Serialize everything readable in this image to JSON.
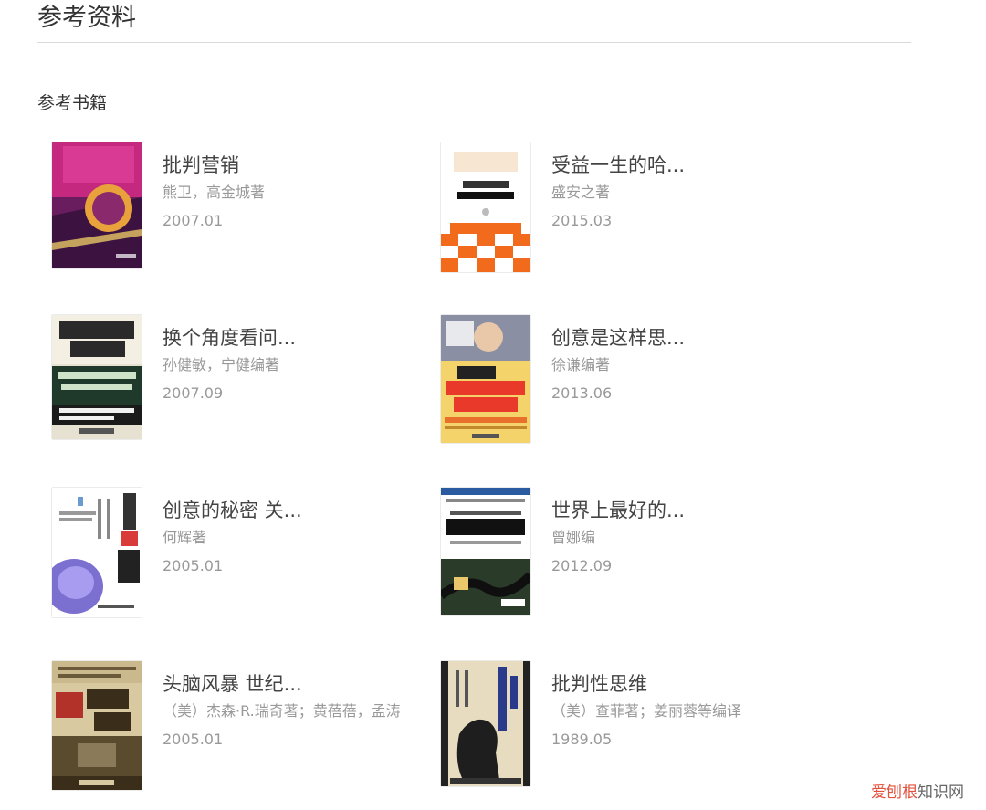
{
  "section_title": "参考资料",
  "sub_title": "参考书籍",
  "books": [
    {
      "title": "批判营销",
      "author": "熊卫，高金城著",
      "date": "2007.01",
      "cover_icon": "book-cover-critical-marketing",
      "cover_colors": [
        "#7a1f6b",
        "#d8338f"
      ]
    },
    {
      "title": "受益一生的哈...",
      "author": "盛安之著",
      "date": "2015.03",
      "cover_icon": "book-cover-harvard-creativity",
      "cover_colors": [
        "#ffffff",
        "#f26b1d"
      ]
    },
    {
      "title": "换个角度看问...",
      "author": "孙健敏，宁健编著",
      "date": "2007.09",
      "cover_icon": "book-cover-solving-problems",
      "cover_colors": [
        "#1f3a2a",
        "#e6e1d0"
      ]
    },
    {
      "title": "创意是这样思...",
      "author": "徐谦编著",
      "date": "2013.06",
      "cover_icon": "book-cover-creativity-thinking",
      "cover_colors": [
        "#f5d36b",
        "#e8702a"
      ]
    },
    {
      "title": "创意的秘密 关...",
      "author": "何辉著",
      "date": "2005.01",
      "cover_icon": "book-cover-secret-of-creativity",
      "cover_colors": [
        "#ffffff",
        "#8c7ed8"
      ]
    },
    {
      "title": "世界上最好的...",
      "author": "曾娜编",
      "date": "2012.09",
      "cover_icon": "book-cover-mind-map",
      "cover_colors": [
        "#ffffff",
        "#2b3b2a"
      ]
    },
    {
      "title": "头脑风暴 世纪...",
      "author": "（美）杰森·R.瑞奇著；黄蓓蓓，孟涛",
      "date": "2005.01",
      "cover_icon": "book-cover-brainstorm",
      "cover_colors": [
        "#d9c9a0",
        "#5a4a2e"
      ]
    },
    {
      "title": "批判性思维",
      "author": "（美）查菲著；姜丽蓉等编译",
      "date": "1989.05",
      "cover_icon": "book-cover-critical-thinking",
      "cover_colors": [
        "#e8dcc0",
        "#222222"
      ]
    }
  ],
  "watermark": {
    "part_a": "爱刨根",
    "part_b": "知识网"
  }
}
